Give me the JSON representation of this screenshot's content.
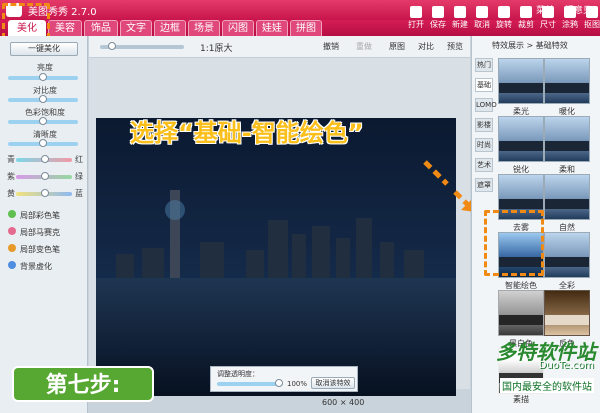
{
  "app": {
    "title": "美图秀秀 2.7.0",
    "top_right": [
      "菜单",
      "提意见"
    ]
  },
  "tabs": [
    "美化",
    "美容",
    "饰品",
    "文字",
    "边框",
    "场景",
    "闪图",
    "娃娃",
    "拼图"
  ],
  "toolbar": [
    "打开",
    "保存",
    "新建",
    "取消",
    "旋转",
    "裁剪",
    "尺寸",
    "涂鸦",
    "抠图"
  ],
  "left_panel": {
    "one_click": "一键美化",
    "adjust": [
      "亮度",
      "对比度",
      "色彩饱和度",
      "清晰度"
    ],
    "color_labels": [
      "青",
      "红",
      "紫",
      "绿",
      "黄",
      "蓝"
    ],
    "tools": [
      "局部彩色笔",
      "局部马赛克",
      "局部变色笔",
      "背景虚化"
    ]
  },
  "main_toolbar": {
    "zoom": "1:1原大",
    "actions": [
      "撤销",
      "重做",
      "原图",
      "对比",
      "预览"
    ]
  },
  "overlay_text": "选择“基础-智能绘色”",
  "right_panel": {
    "breadcrumb": "特效展示 > 基础特效",
    "vtabs": [
      "热门",
      "基础",
      "LOMO",
      "影楼",
      "时尚",
      "艺术",
      "遮罩"
    ],
    "items": [
      {
        "label": "柔光"
      },
      {
        "label": "暖化"
      },
      {
        "label": "锐化"
      },
      {
        "label": "柔和"
      },
      {
        "label": "去雾"
      },
      {
        "label": "自然"
      },
      {
        "label": "智能绘色"
      },
      {
        "label": "全彩"
      },
      {
        "label": "黑白色"
      },
      {
        "label": "反色"
      },
      {
        "label": "素描"
      }
    ]
  },
  "bottom": {
    "dialog": {
      "label": "调整透明度：",
      "value": "100%",
      "cancel": "取消该特效"
    },
    "status": "600 × 400"
  },
  "step_label": "第七步:",
  "watermark": {
    "main": "多特软件站",
    "sub": "DuoTe.com",
    "bottom": "国内最安全的软件站"
  },
  "colors": {
    "brand": "#d61c55",
    "highlight": "#f08a14",
    "step": "#57a832"
  }
}
